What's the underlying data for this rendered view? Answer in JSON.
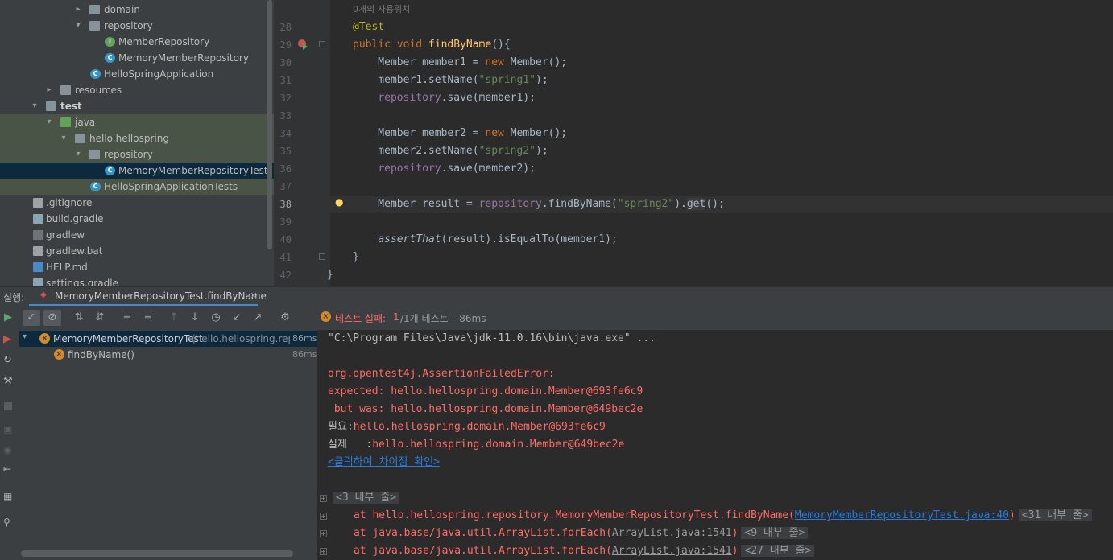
{
  "tree": {
    "items": [
      {
        "label": "domain",
        "icon": "folder-icon",
        "arrow": "›"
      },
      {
        "label": "repository",
        "icon": "folder-icon",
        "arrow": "⌄"
      },
      {
        "label": "MemberRepository",
        "icon": "interface-icon",
        "arrow": ""
      },
      {
        "label": "MemoryMemberRepository",
        "icon": "class-icon",
        "arrow": ""
      },
      {
        "label": "HelloSpringApplication",
        "icon": "spring-class-icon",
        "arrow": ""
      },
      {
        "label": "resources",
        "icon": "resources-folder-icon",
        "arrow": "›"
      },
      {
        "label": "test",
        "icon": "folder-icon",
        "arrow": "⌄"
      },
      {
        "label": "java",
        "icon": "test-folder-icon",
        "arrow": "⌄"
      },
      {
        "label": "hello.hellospring",
        "icon": "package-icon",
        "arrow": "⌄"
      },
      {
        "label": "repository",
        "icon": "package-icon",
        "arrow": "⌄"
      },
      {
        "label": "MemoryMemberRepositoryTest",
        "icon": "test-class-icon",
        "arrow": ""
      },
      {
        "label": "HelloSpringApplicationTests",
        "icon": "test-class-icon",
        "arrow": ""
      },
      {
        "label": ".gitignore",
        "icon": "file-icon",
        "arrow": ""
      },
      {
        "label": "build.gradle",
        "icon": "gradle-icon",
        "arrow": ""
      },
      {
        "label": "gradlew",
        "icon": "terminal-file-icon",
        "arrow": ""
      },
      {
        "label": "gradlew.bat",
        "icon": "file-icon",
        "arrow": ""
      },
      {
        "label": "HELP.md",
        "icon": "markdown-icon",
        "arrow": ""
      },
      {
        "label": "settings.gradle",
        "icon": "gradle-icon",
        "arrow": ""
      }
    ]
  },
  "editor": {
    "usage_hint": "0개의 사용위치",
    "line_numbers": [
      "28",
      "29",
      "30",
      "31",
      "32",
      "33",
      "34",
      "35",
      "36",
      "37",
      "38",
      "39",
      "40",
      "41",
      "42"
    ]
  },
  "run": {
    "label": "실행:",
    "tab": "MemoryMemberRepositoryTest.findByName",
    "status_prefix": "테스트 실패:",
    "status_count": "1",
    "status_suffix": "/1개 테스트 – 86ms",
    "tests": [
      {
        "name": "MemoryMemberRepositoryTest",
        "pkg": "(hello.hellospring.repos",
        "time": "86ms"
      },
      {
        "name": "findByName()",
        "pkg": "",
        "time": "86ms"
      }
    ]
  },
  "console": {
    "cmd": "\"C:\\Program Files\\Java\\jdk-11.0.16\\bin\\java.exe\" ...",
    "error": "org.opentest4j.AssertionFailedError:",
    "expected": "expected: hello.hellospring.domain.Member@693fe6c9",
    "butwas": " but was: hello.hellospring.domain.Member@649bec2e",
    "need_label": "필요:",
    "need_val": "hello.hellospring.domain.Member@693fe6c9",
    "actual_label": "실제   :",
    "actual_val": "hello.hellospring.domain.Member@649bec2e",
    "diff_link": "<클릭하여 차이점 확인>",
    "inner1": "<3 내부 줄>",
    "st1_pre": "at hello.hellospring.repository.MemoryMemberRepositoryTest.findByName(",
    "st1_link": "MemoryMemberRepositoryTest.java:40",
    "st1_chip": "<31 내부 줄>",
    "st2_pre": "at java.base/java.util.ArrayList.forEach(",
    "st2_link": "ArrayList.java:1541",
    "st2_chip": "<9 내부 줄>",
    "st3_pre": "at java.base/java.util.ArrayList.forEach(",
    "st3_link": "ArrayList.java:1541",
    "st3_chip": "<27 내부 줄>"
  },
  "colors": {
    "error": "#ff6b68",
    "link": "#287bde",
    "keyword": "#cc7832",
    "string": "#6a8759"
  }
}
